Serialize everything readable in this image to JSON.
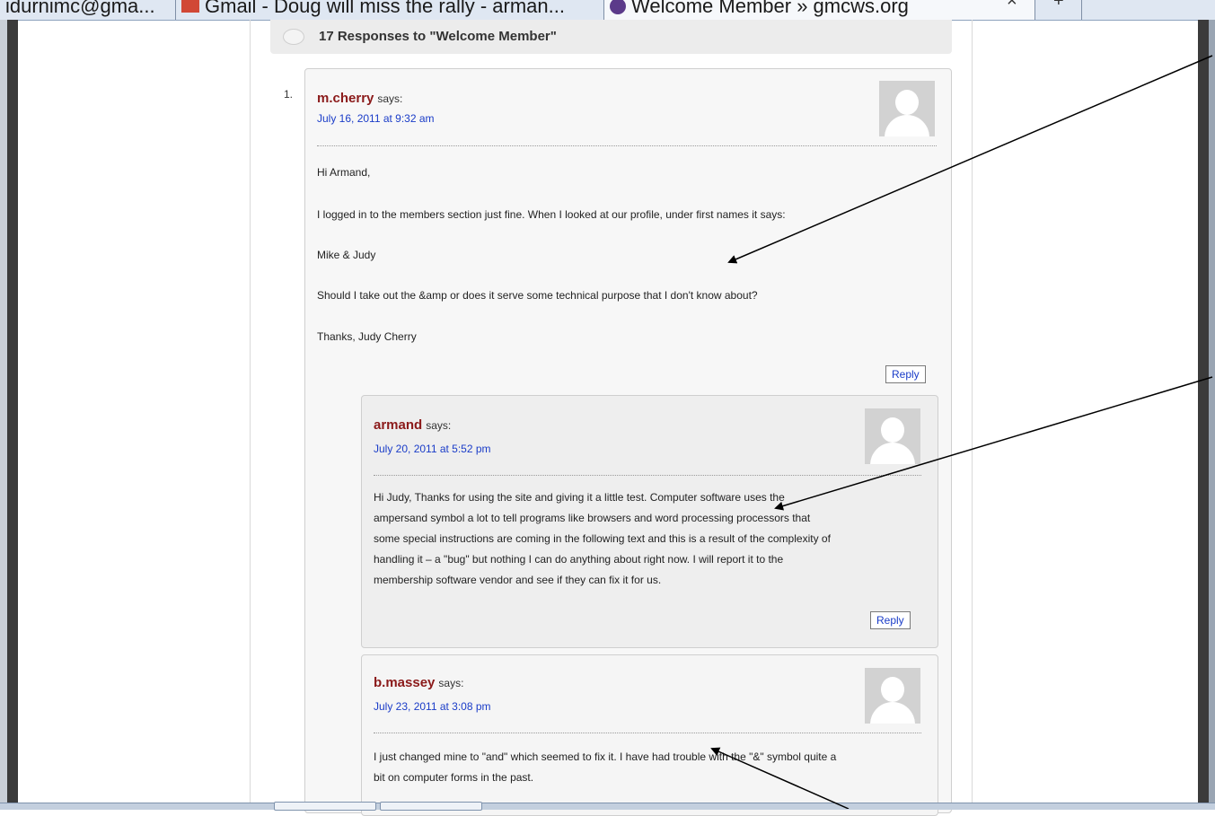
{
  "tabs": [
    {
      "label": "idurnimc@gma..."
    },
    {
      "label": "Gmail - Doug will miss the rally - arman..."
    },
    {
      "label": "Welcome Member » gmcws.org"
    }
  ],
  "tab_close_glyph": "×",
  "new_tab_glyph": "+",
  "responses_header": "17 Responses to \"Welcome Member\"",
  "comments": [
    {
      "number": "1.",
      "author": "m.cherry",
      "says": "says:",
      "date": "July 16, 2011 at 9:32 am",
      "paragraphs": [
        "Hi Armand,",
        "I logged in to the members section just fine. When I looked at our profile, under first names it says:",
        "Mike & Judy",
        "Should I take out the &amp or does it serve some technical purpose that I don't know about?",
        "Thanks, Judy Cherry"
      ],
      "reply": "Reply"
    },
    {
      "author": "armand",
      "says": "says:",
      "date": "July 20, 2011 at 5:52 pm",
      "body_lines": [
        "Hi Judy, Thanks for using the site and giving it a little test. Computer software uses the",
        "ampersand symbol a lot to tell programs like browsers and word processing processors that",
        "some special instructions are coming in the following text and this is a result of the complexity of",
        "handling it – a \"bug\" but nothing I can do anything about right now. I will report it to the",
        "membership software vendor and see if they can fix it for us."
      ],
      "reply": "Reply"
    },
    {
      "author": "b.massey",
      "says": "says:",
      "date": "July 23, 2011 at 3:08 pm",
      "body_lines": [
        "I just changed mine to \"and\" which seemed to fix it. I have had trouble with the \"&\" symbol quite a",
        "bit on computer forms in the past."
      ]
    }
  ],
  "colors": {
    "author": "#8b1a1a",
    "link": "#1a3cc8",
    "frame": "#3b3b3b"
  }
}
